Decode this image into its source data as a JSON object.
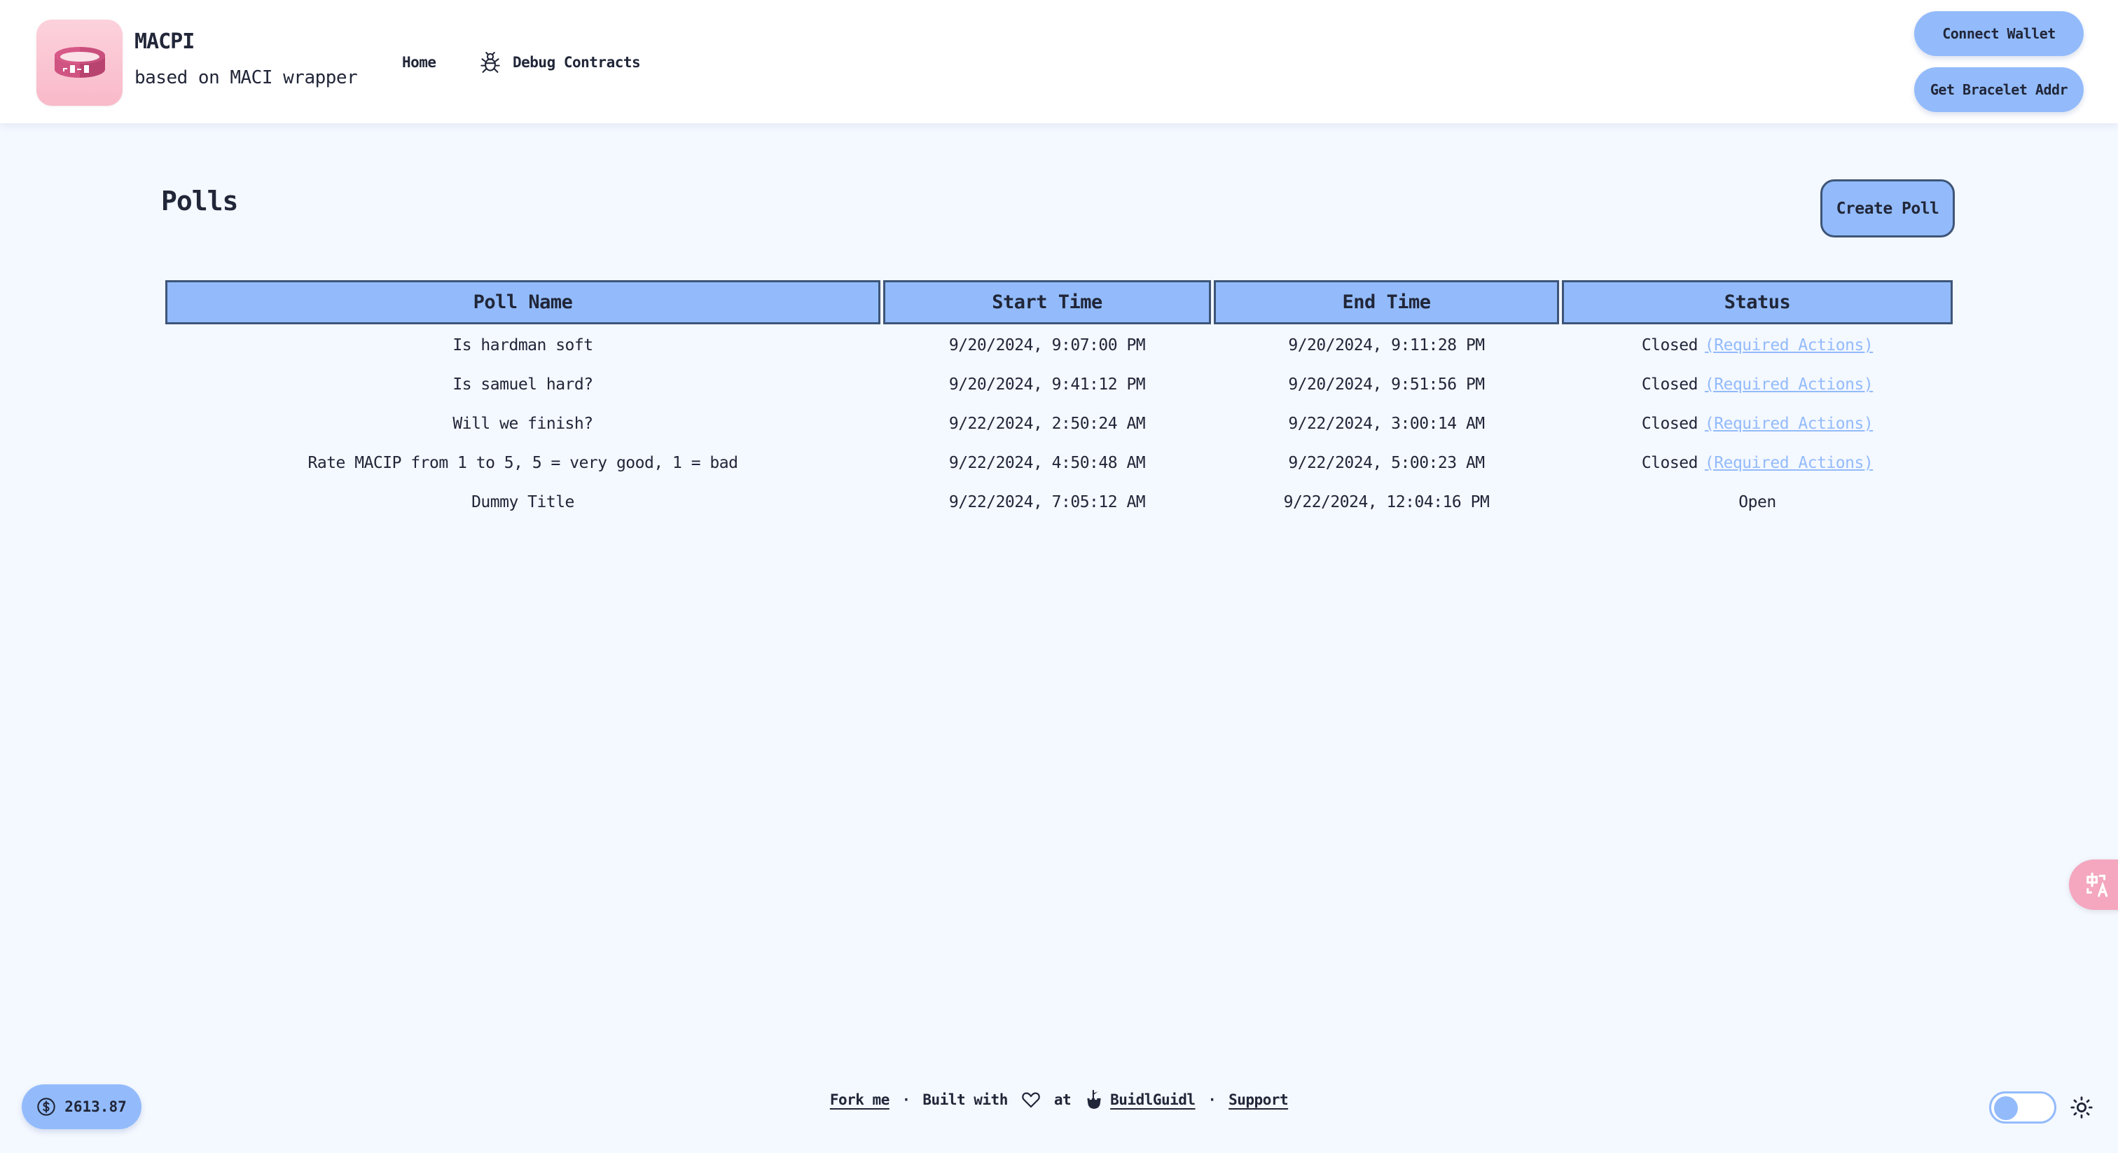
{
  "header": {
    "logo_icon": "bracelet-logo-icon",
    "title": "MACPI",
    "subtitle": "based on MACI wrapper",
    "nav": [
      {
        "label": "Home",
        "icon": null
      },
      {
        "label": "Debug Contracts",
        "icon": "bug-icon"
      }
    ],
    "connect_wallet_label": "Connect Wallet",
    "bracelet_button_label": "Get Bracelet Addr"
  },
  "main": {
    "title": "Polls",
    "create_poll_label": "Create Poll",
    "table": {
      "columns": [
        "Poll Name",
        "Start Time",
        "End Time",
        "Status"
      ],
      "rows": [
        {
          "name": "Is hardman soft",
          "start": "9/20/2024, 9:07:00 PM",
          "end": "9/20/2024, 9:11:28 PM",
          "status": "Closed",
          "action": "(Required Actions)"
        },
        {
          "name": "Is samuel hard?",
          "start": "9/20/2024, 9:41:12 PM",
          "end": "9/20/2024, 9:51:56 PM",
          "status": "Closed",
          "action": "(Required Actions)"
        },
        {
          "name": "Will we finish?",
          "start": "9/22/2024, 2:50:24 AM",
          "end": "9/22/2024, 3:00:14 AM",
          "status": "Closed",
          "action": "(Required Actions)"
        },
        {
          "name": "Rate MACIP from 1 to 5, 5 = very good, 1 = bad",
          "start": "9/22/2024, 4:50:48 AM",
          "end": "9/22/2024, 5:00:23 AM",
          "status": "Closed",
          "action": "(Required Actions)"
        },
        {
          "name": "Dummy Title",
          "start": "9/22/2024, 7:05:12 AM",
          "end": "9/22/2024, 12:04:16 PM",
          "status": "Open",
          "action": null
        }
      ]
    }
  },
  "footer": {
    "fork_label": "Fork me",
    "separator": "·",
    "built_with_label": "Built with",
    "heart_icon": "heart-icon",
    "at_label": "at",
    "buidlguidl_icon": "castle-icon",
    "buidlguidl_label": "BuidlGuidl",
    "support_label": "Support"
  },
  "balance": {
    "icon": "dollar-icon",
    "value": "2613.87"
  },
  "theme": {
    "mode": "light",
    "icon": "sun-icon"
  },
  "translate": {
    "icon": "translate-icon"
  },
  "colors": {
    "accent": "#93bbfb",
    "border": "#3d5578",
    "text": "#212638",
    "background": "#f4f8ff",
    "logo_pink": "#f9b9c9",
    "translate_pink": "#f4a7bf"
  }
}
